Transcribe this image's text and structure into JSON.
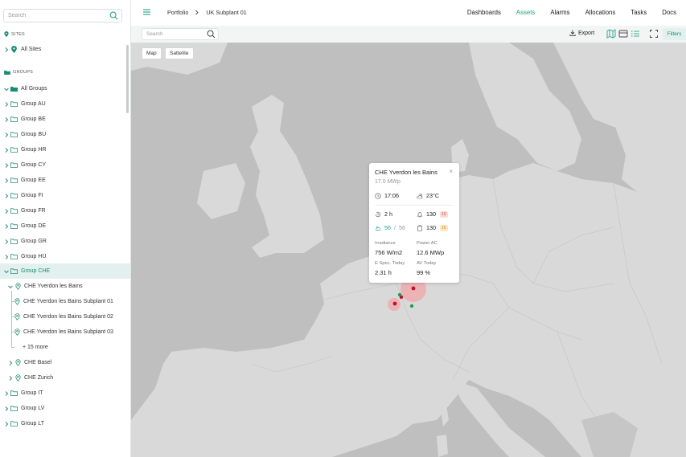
{
  "sidebar": {
    "search_placeholder": "Search",
    "sites_label": "SITES",
    "all_sites": "All Sites",
    "groups_label": "GROUPS",
    "all_groups": "All Groups",
    "groups": [
      "Group AU",
      "Group BE",
      "Group BU",
      "Group HR",
      "Group CY",
      "Group EE",
      "Group FI",
      "Group FR",
      "Group DE",
      "Group GR",
      "Group HU"
    ],
    "active_group": "Group CHE",
    "che_site": "CHE Yverdon les Bains",
    "subplants": [
      "CHE Yverdon les Bains Subplant 01",
      "CHE Yverdon les Bains Subplant 02",
      "CHE Yverdon les Bains Subplant 03"
    ],
    "more": "+ 15 more",
    "che_other": [
      "CHE Basel",
      "CHE Zurich"
    ],
    "groups_after": [
      "Group IT",
      "Group LV",
      "Group LT"
    ]
  },
  "header": {
    "breadcrumbs": [
      "Portfolio",
      "UK Subplant 01"
    ],
    "nav": [
      "Dashboards",
      "Assets",
      "Alarms",
      "Allocations",
      "Tasks",
      "Docs"
    ],
    "active_nav": "Assets"
  },
  "toolbar": {
    "search_placeholder": "Search",
    "export": "Export",
    "filters": "Filters"
  },
  "map": {
    "type_map": "Map",
    "type_satellite": "Sattelite"
  },
  "popup": {
    "title": "CHE Yverdon les Bains",
    "capacity": "17.0 MWp",
    "time": "17:06",
    "temperature": "23°C",
    "duration": "2 h",
    "alarms": "130",
    "alarms_badge": "16",
    "tasks": "130",
    "tasks_badge": "16",
    "devices_ok": "56",
    "devices_sep": "/",
    "devices_total": "56",
    "irradiance_label": "Irradiance",
    "irradiance_value": "756 W/m2",
    "power_label": "Power AC",
    "power_value": "12.6 MWp",
    "espec_label": "E Spec. Today",
    "espec_value": "2.31 h",
    "av_label": "AV Today",
    "av_value": "99 %",
    "close": "×"
  },
  "colors": {
    "accent": "#22a388",
    "marker_red": "#c0102a",
    "marker_green": "#1f9d55"
  }
}
